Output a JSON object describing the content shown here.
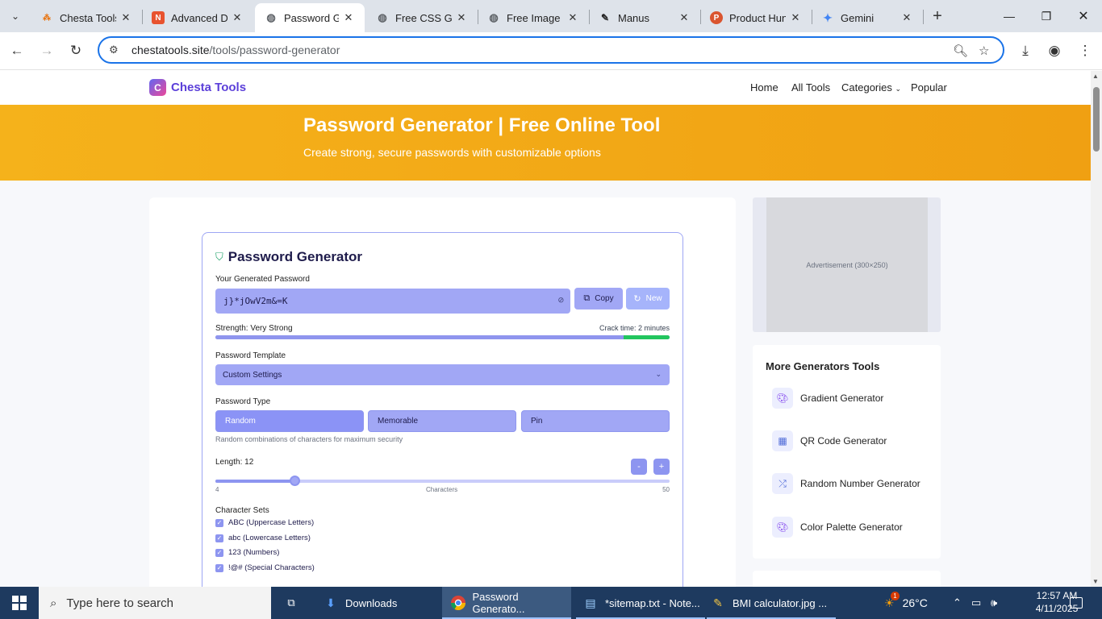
{
  "browser": {
    "tabs": [
      {
        "title": "Chesta Tools",
        "fav_color": "#e8710a",
        "fav_glyph": "⁂",
        "icon": "chesta-favicon"
      },
      {
        "title": "Advanced DN",
        "fav_color": "#e8532f",
        "fav_glyph": "N",
        "icon": "advanced-favicon"
      },
      {
        "title": "Password Ge",
        "fav_color": "#5f6368",
        "fav_glyph": "🌐",
        "icon": "globe-favicon"
      },
      {
        "title": "Free CSS Gra",
        "fav_color": "#5f6368",
        "fav_glyph": "🌐",
        "icon": "globe-favicon"
      },
      {
        "title": "Free Image R",
        "fav_color": "#5f6368",
        "fav_glyph": "🌐",
        "icon": "globe-favicon"
      },
      {
        "title": "Manus",
        "fav_color": "#222222",
        "fav_glyph": "✎",
        "icon": "manus-favicon"
      },
      {
        "title": "Product Hun",
        "fav_color": "#da552f",
        "fav_glyph": "P",
        "icon": "producthunt-favicon"
      },
      {
        "title": "Gemini",
        "fav_color": "#4285f4",
        "fav_glyph": "✦",
        "icon": "gemini-favicon"
      }
    ],
    "active_tab_index": 2,
    "url_host": "chestatools.site",
    "url_path": "/tools/password-generator"
  },
  "site": {
    "logo_letter": "C",
    "logo_name": "Chesta Tools",
    "menu": [
      {
        "label": "Home"
      },
      {
        "label": "All Tools"
      },
      {
        "label": "Categories"
      },
      {
        "label": "Popular"
      }
    ],
    "hero_title": "Password Generator | Free Online Tool",
    "hero_subtitle": "Create strong, secure passwords with customizable options"
  },
  "tool": {
    "title": "Password Generator",
    "generated_label": "Your Generated Password",
    "password": "j}*jOwV2m&=K",
    "copy_label": "Copy",
    "new_label": "New",
    "strength_text": "Strength: Very Strong",
    "crack_time": "Crack time: 2 minutes",
    "template_label": "Password Template",
    "template_value": "Custom Settings",
    "type_label": "Password Type",
    "types": [
      {
        "label": "Random"
      },
      {
        "label": "Memorable"
      },
      {
        "label": "Pin"
      }
    ],
    "active_type_index": 0,
    "type_hint": "Random combinations of characters for maximum security",
    "length_label": "Length: 12",
    "length_value": 12,
    "length_min": 4,
    "length_max": 50,
    "minus_label": "-",
    "plus_label": "+",
    "min_tick": "4",
    "mid_tick": "Characters",
    "max_tick": "50",
    "charsets_label": "Character Sets",
    "charsets": [
      {
        "label": "ABC (Uppercase Letters)",
        "checked": true
      },
      {
        "label": "abc (Lowercase Letters)",
        "checked": true
      },
      {
        "label": "123 (Numbers)",
        "checked": true
      },
      {
        "label": "!@# (Special Characters)",
        "checked": true
      }
    ]
  },
  "sidebar": {
    "ad_text": "Advertisement (300×250)",
    "heading": "More Generators Tools",
    "items": [
      {
        "label": "Gradient Generator",
        "icon": "palette-icon"
      },
      {
        "label": "QR Code Generator",
        "icon": "qr-icon"
      },
      {
        "label": "Random Number Generator",
        "icon": "shuffle-icon"
      },
      {
        "label": "Color Palette Generator",
        "icon": "palette-icon"
      }
    ]
  },
  "taskbar": {
    "search_placeholder": "Type here to search",
    "items": [
      {
        "label": "Downloads"
      },
      {
        "label": "Password Generato..."
      },
      {
        "label": "*sitemap.txt - Note..."
      },
      {
        "label": "BMI calculator.jpg ..."
      }
    ],
    "weather": "26°C",
    "notification_count": "1",
    "time": "12:57 AM",
    "date": "4/11/2025"
  }
}
